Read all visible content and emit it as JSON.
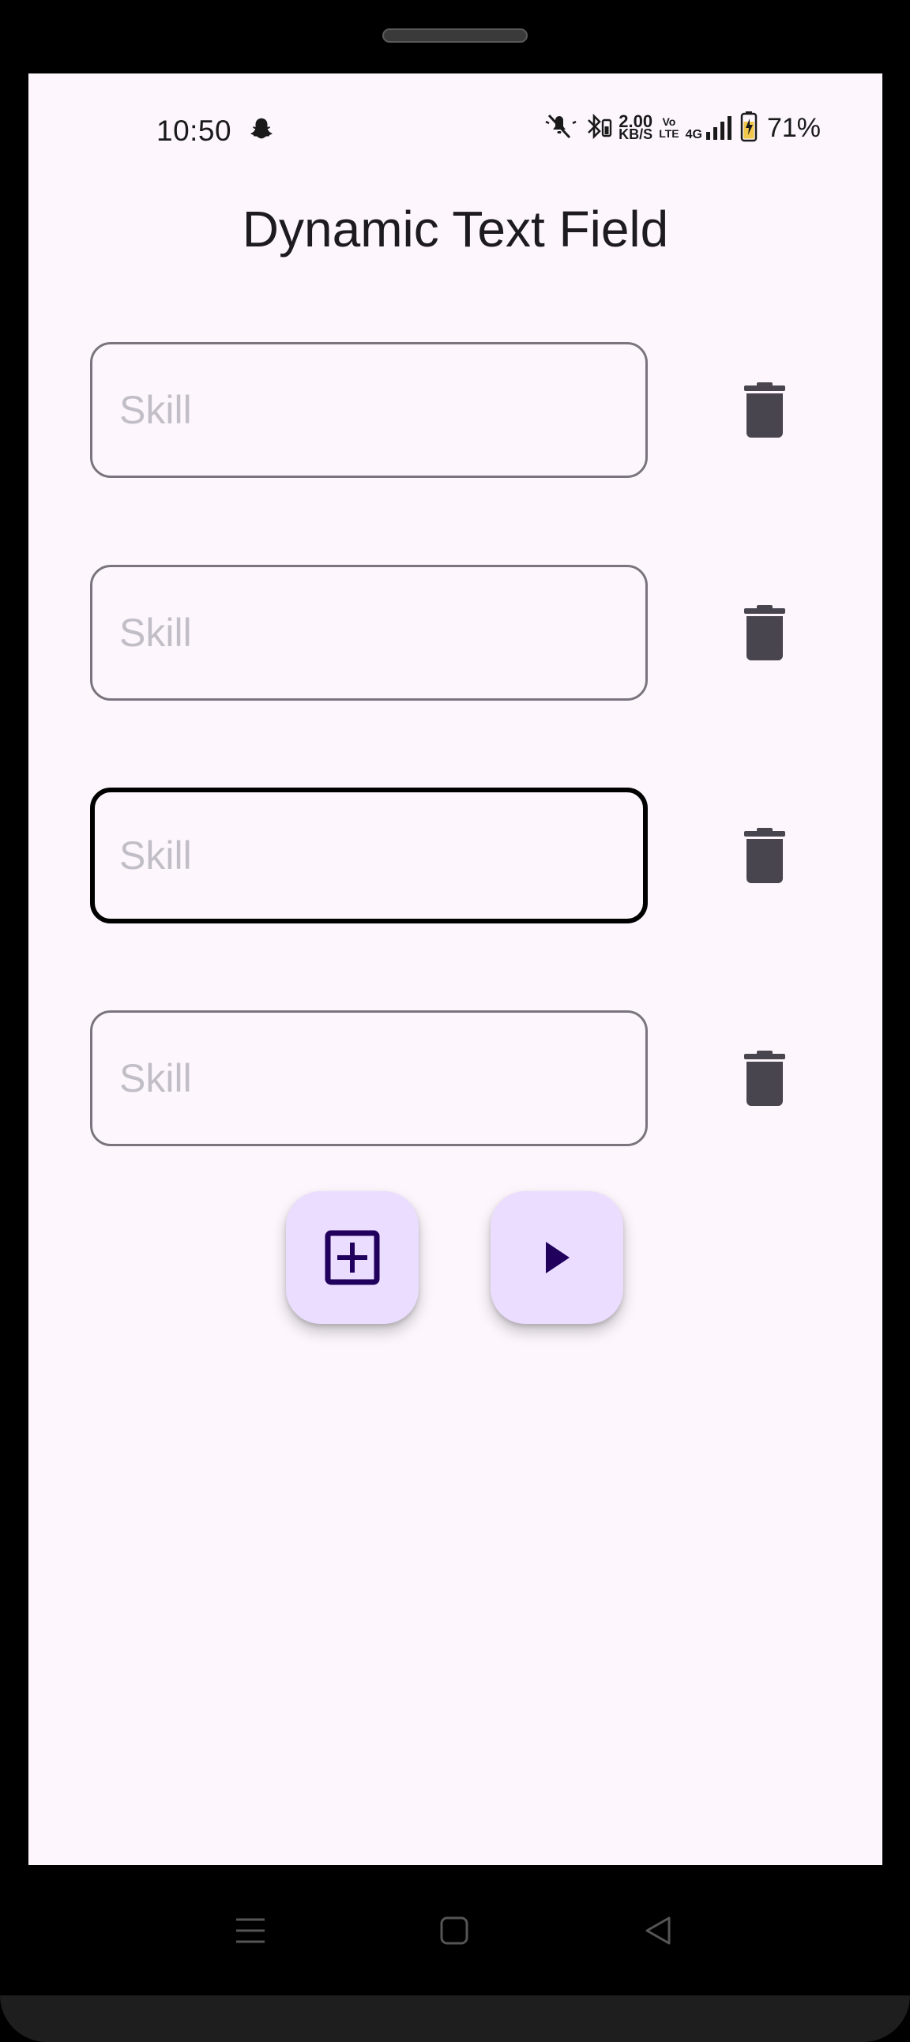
{
  "status_bar": {
    "time": "10:50",
    "net_speed_value": "2.00",
    "net_speed_unit": "KB/S",
    "volte_top": "Vo",
    "volte_bottom": "LTE",
    "network_type": "4G",
    "battery_percent": "71%",
    "icons": [
      "snapchat-icon",
      "mute-icon",
      "bluetooth-battery-icon",
      "signal-icon",
      "battery-charging-icon"
    ]
  },
  "app": {
    "title": "Dynamic Text Field"
  },
  "fields": [
    {
      "placeholder": "Skill",
      "value": "",
      "focused": false
    },
    {
      "placeholder": "Skill",
      "value": "",
      "focused": false
    },
    {
      "placeholder": "Skill",
      "value": "",
      "focused": true
    },
    {
      "placeholder": "Skill",
      "value": "",
      "focused": false
    }
  ],
  "actions": {
    "add_icon": "add-box-icon",
    "run_icon": "play-icon"
  },
  "colors": {
    "background": "#fdf7fd",
    "fab_background": "#eaddff",
    "fab_icon": "#21005d",
    "field_border": "#79747e",
    "field_border_focused": "#000000",
    "placeholder": "#c2bec7",
    "delete_icon": "#49454f",
    "title": "#1d1b20"
  },
  "navigation": {
    "icons": [
      "menu-icon",
      "home-icon",
      "back-icon"
    ]
  }
}
